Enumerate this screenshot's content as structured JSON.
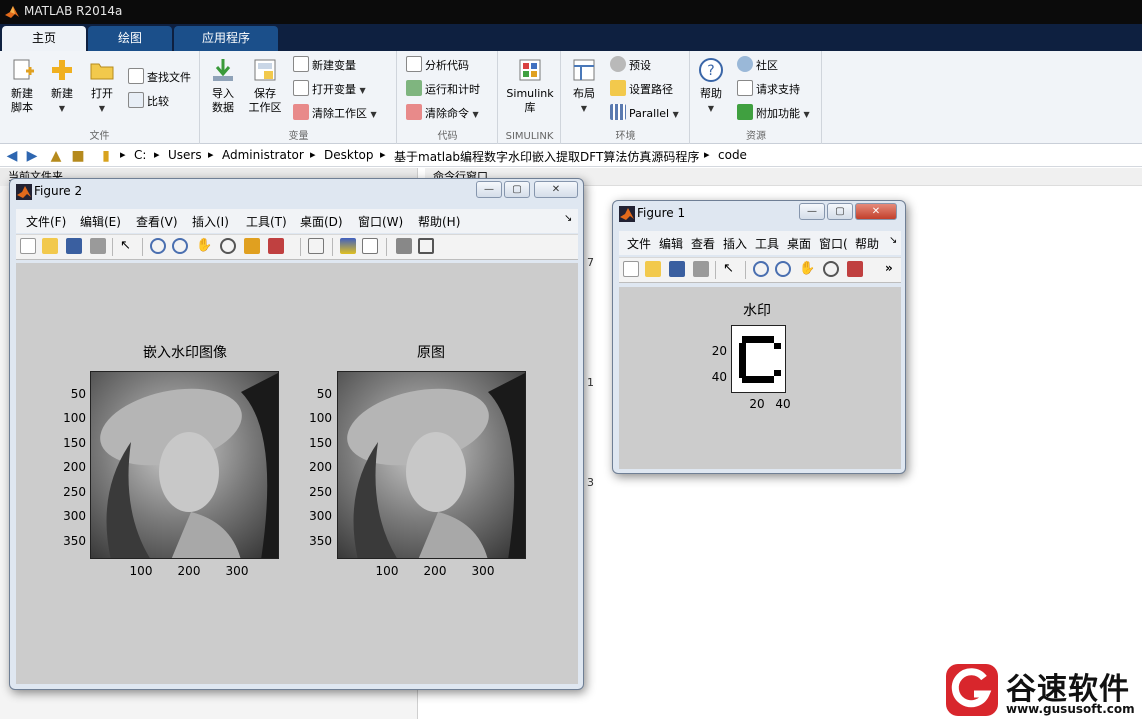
{
  "window": {
    "title": "MATLAB R2014a"
  },
  "tabs": [
    {
      "label": "主页",
      "active": true
    },
    {
      "label": "绘图",
      "active": false
    },
    {
      "label": "应用程序",
      "active": false
    }
  ],
  "ribbon": {
    "file": {
      "group": "文件",
      "new_script_1": "新建",
      "new_script_2": "脚本",
      "new": "新建",
      "open": "打开",
      "find_files": "查找文件",
      "compare": "比较"
    },
    "variable": {
      "group": "变量",
      "import_1": "导入",
      "import_2": "数据",
      "save_1": "保存",
      "save_2": "工作区",
      "new_var": "新建变量",
      "open_var": "打开变量",
      "clear_ws": "清除工作区"
    },
    "code": {
      "group": "代码",
      "analyze": "分析代码",
      "run_time": "运行和计时",
      "clear_cmd": "清除命令"
    },
    "simulink": {
      "group": "SIMULINK",
      "lib_1": "Simulink",
      "lib_2": "库"
    },
    "env": {
      "group": "环境",
      "layout": "布局",
      "prefs": "预设",
      "set_path": "设置路径",
      "parallel": "Parallel"
    },
    "resources": {
      "group": "资源",
      "help": "帮助",
      "community": "社区",
      "support": "请求支持",
      "addons": "附加功能"
    }
  },
  "address": {
    "crumbs": [
      "C:",
      "Users",
      "Administrator",
      "Desktop",
      "基于matlab编程数字水印嵌入提取DFT算法仿真源码程序",
      "code"
    ]
  },
  "panes": {
    "current_folder": "当前文件夹",
    "command_window": "命令行窗口",
    "cmd_numbers": [
      "7",
      "1",
      "3"
    ]
  },
  "figure2": {
    "title": "Figure 2",
    "menu": [
      "文件(F)",
      "编辑(E)",
      "查看(V)",
      "插入(I)",
      "工具(T)",
      "桌面(D)",
      "窗口(W)",
      "帮助(H)"
    ],
    "subplots": [
      {
        "title": "嵌入水印图像",
        "yticks": [
          "50",
          "100",
          "150",
          "200",
          "250",
          "300",
          "350"
        ],
        "xticks": [
          "100",
          "200",
          "300"
        ]
      },
      {
        "title": "原图",
        "yticks": [
          "50",
          "100",
          "150",
          "200",
          "250",
          "300",
          "350"
        ],
        "xticks": [
          "100",
          "200",
          "300"
        ]
      }
    ]
  },
  "figure1": {
    "title": "Figure 1",
    "menu": [
      "文件",
      "编辑",
      "查看",
      "插入",
      "工具",
      "桌面",
      "窗口(",
      "帮助"
    ],
    "plot": {
      "title": "水印",
      "yticks": [
        "20",
        "40"
      ],
      "xticks": [
        "20",
        "40"
      ]
    }
  },
  "watermark": {
    "name": "谷速软件",
    "url": "www.gususoft.com"
  },
  "colors": {
    "titlebar": "#0b0b0b",
    "tabbar": "#0e2040",
    "accent": "#d8262c"
  }
}
